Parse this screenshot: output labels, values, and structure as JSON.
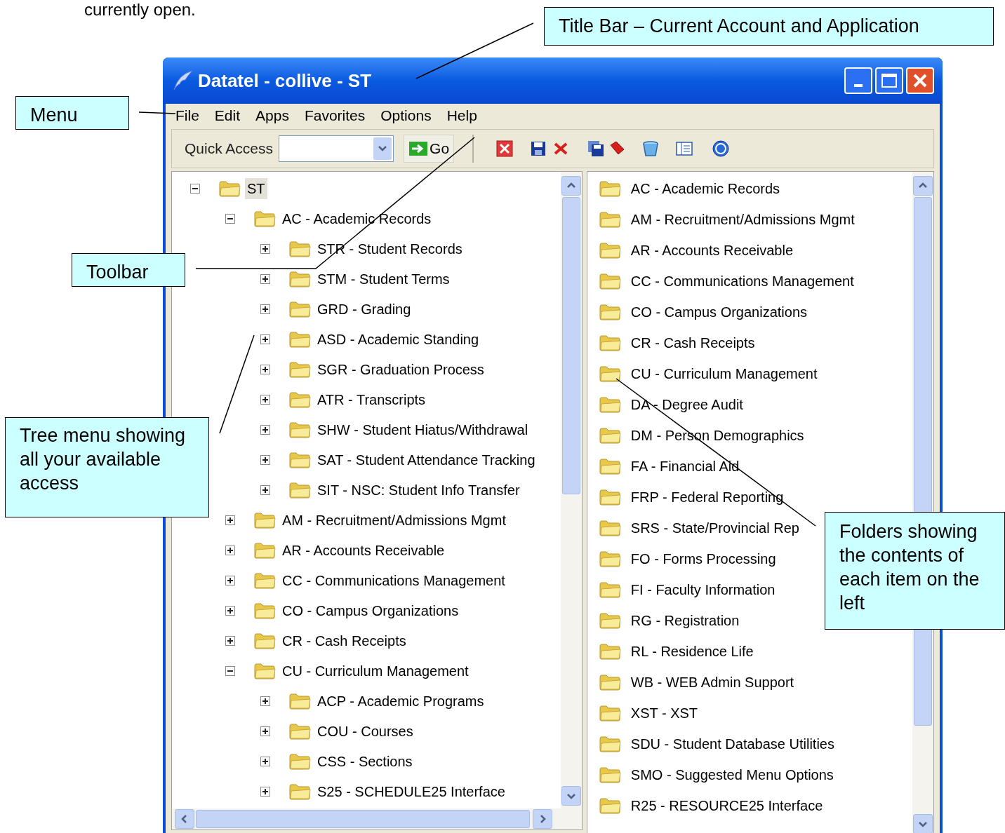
{
  "document": {
    "text_above": "currently open."
  },
  "window": {
    "title": "Datatel - collive - ST"
  },
  "menu": [
    "File",
    "Edit",
    "Apps",
    "Favorites",
    "Options",
    "Help"
  ],
  "toolbar": {
    "quick_access_label": "Quick Access",
    "go_button": "Go"
  },
  "tree": [
    {
      "label": "ST",
      "expanded": true,
      "selected": true,
      "children": [
        {
          "label": "AC - Academic Records",
          "expanded": true,
          "selected": false,
          "children": [
            {
              "label": "STR - Student Records",
              "expanded": false,
              "selected": false
            },
            {
              "label": "STM - Student Terms",
              "expanded": false,
              "selected": false
            },
            {
              "label": "GRD - Grading",
              "expanded": false,
              "selected": false
            },
            {
              "label": "ASD - Academic Standing",
              "expanded": false,
              "selected": false
            },
            {
              "label": "SGR - Graduation Process",
              "expanded": false,
              "selected": false
            },
            {
              "label": "ATR - Transcripts",
              "expanded": false,
              "selected": false
            },
            {
              "label": "SHW - Student Hiatus/Withdrawal",
              "expanded": false,
              "selected": false
            },
            {
              "label": "SAT - Student Attendance Tracking",
              "expanded": false,
              "selected": false
            },
            {
              "label": "SIT - NSC: Student Info Transfer",
              "expanded": false,
              "selected": false
            }
          ]
        },
        {
          "label": "AM - Recruitment/Admissions Mgmt",
          "expanded": false,
          "selected": false
        },
        {
          "label": "AR - Accounts Receivable",
          "expanded": false,
          "selected": false
        },
        {
          "label": "CC - Communications Management",
          "expanded": false,
          "selected": false
        },
        {
          "label": "CO - Campus Organizations",
          "expanded": false,
          "selected": false
        },
        {
          "label": "CR - Cash Receipts",
          "expanded": false,
          "selected": false
        },
        {
          "label": "CU - Curriculum Management",
          "expanded": true,
          "selected": false,
          "children": [
            {
              "label": "ACP - Academic Programs",
              "expanded": false,
              "selected": false
            },
            {
              "label": "COU - Courses",
              "expanded": false,
              "selected": false
            },
            {
              "label": "CSS - Sections",
              "expanded": false,
              "selected": false
            },
            {
              "label": "S25 - SCHEDULE25 Interface",
              "expanded": false,
              "selected": false
            }
          ]
        }
      ]
    }
  ],
  "folders": [
    "AC - Academic Records",
    "AM - Recruitment/Admissions Mgmt",
    "AR - Accounts Receivable",
    "CC - Communications Management",
    "CO - Campus Organizations",
    "CR - Cash Receipts",
    "CU - Curriculum Management",
    "DA - Degree Audit",
    "DM - Person Demographics",
    "FA - Financial Aid",
    "FRP - Federal Reporting",
    "SRS - State/Provincial Rep",
    "FO - Forms Processing",
    "FI - Faculty Information",
    "RG - Registration",
    "RL - Residence Life",
    "WB - WEB Admin Support",
    "XST - XST",
    "SDU - Student Database Utilities",
    "SMO - Suggested Menu Options",
    "R25 - RESOURCE25 Interface"
  ],
  "callouts": [
    {
      "text": "Title Bar – Current Account and Application"
    },
    {
      "text": "Menu"
    },
    {
      "text": "Toolbar"
    },
    {
      "text": "Tree menu showing all your available access"
    },
    {
      "text": "Folders showing the contents of each item on the left"
    }
  ]
}
